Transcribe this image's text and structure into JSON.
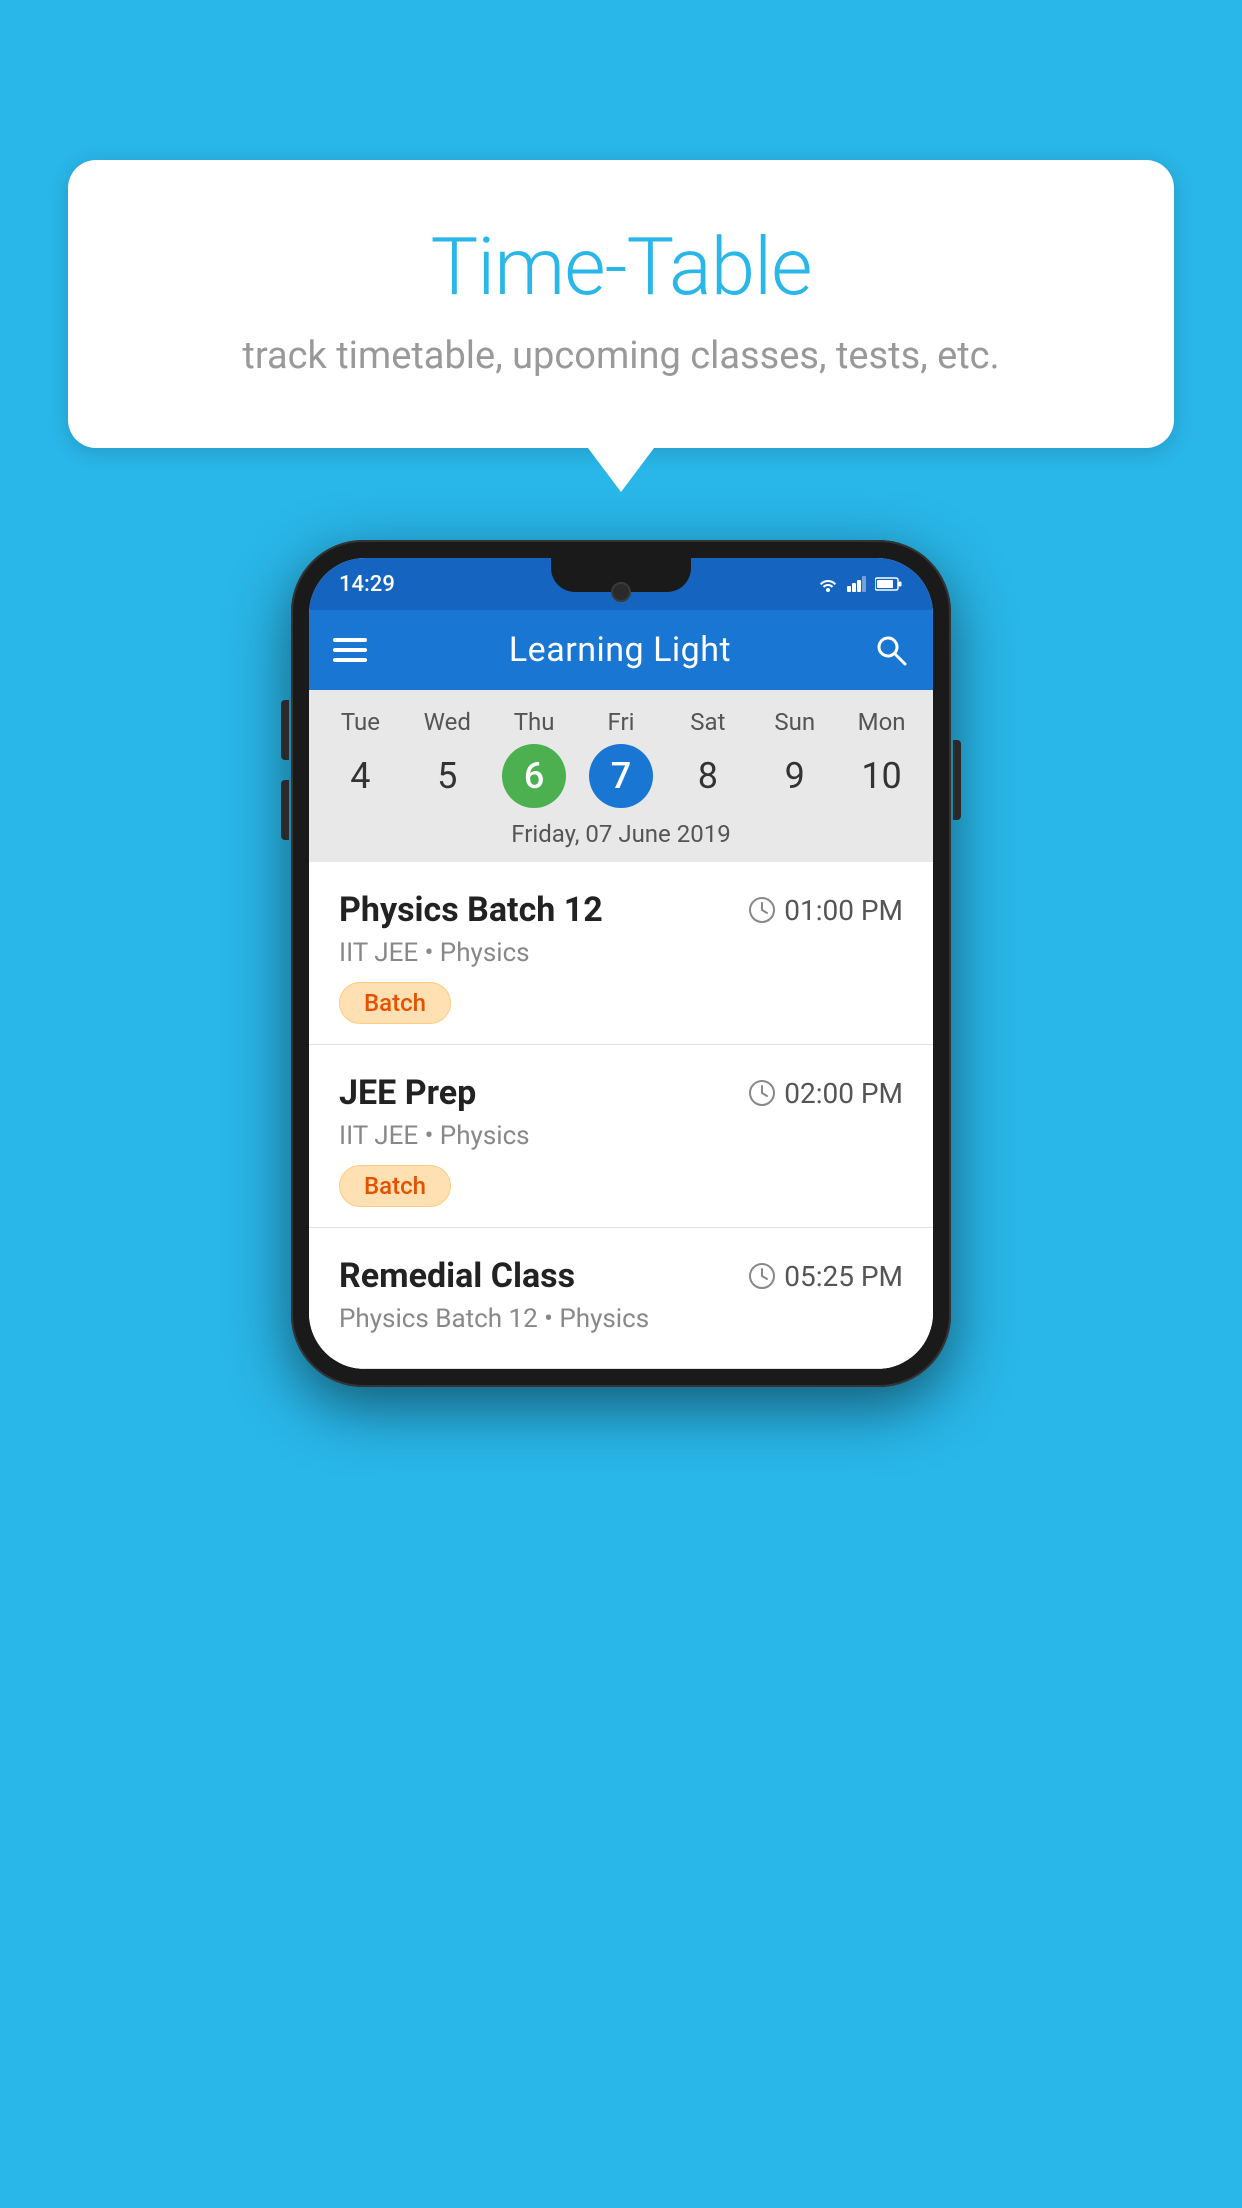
{
  "background_color": "#29B6E8",
  "tooltip": {
    "title": "Time-Table",
    "subtitle": "track timetable, upcoming classes, tests, etc."
  },
  "phone": {
    "status_bar": {
      "time": "14:29"
    },
    "app_bar": {
      "title": "Learning Light"
    },
    "calendar": {
      "days": [
        "Tue",
        "Wed",
        "Thu",
        "Fri",
        "Sat",
        "Sun",
        "Mon"
      ],
      "dates": [
        "4",
        "5",
        "6",
        "7",
        "8",
        "9",
        "10"
      ],
      "today_index": 2,
      "selected_index": 3,
      "selected_label": "Friday, 07 June 2019"
    },
    "schedule": [
      {
        "name": "Physics Batch 12",
        "time": "01:00 PM",
        "meta": "IIT JEE • Physics",
        "badge": "Batch"
      },
      {
        "name": "JEE Prep",
        "time": "02:00 PM",
        "meta": "IIT JEE • Physics",
        "badge": "Batch"
      },
      {
        "name": "Remedial Class",
        "time": "05:25 PM",
        "meta": "Physics Batch 12 • Physics",
        "badge": null
      }
    ]
  }
}
